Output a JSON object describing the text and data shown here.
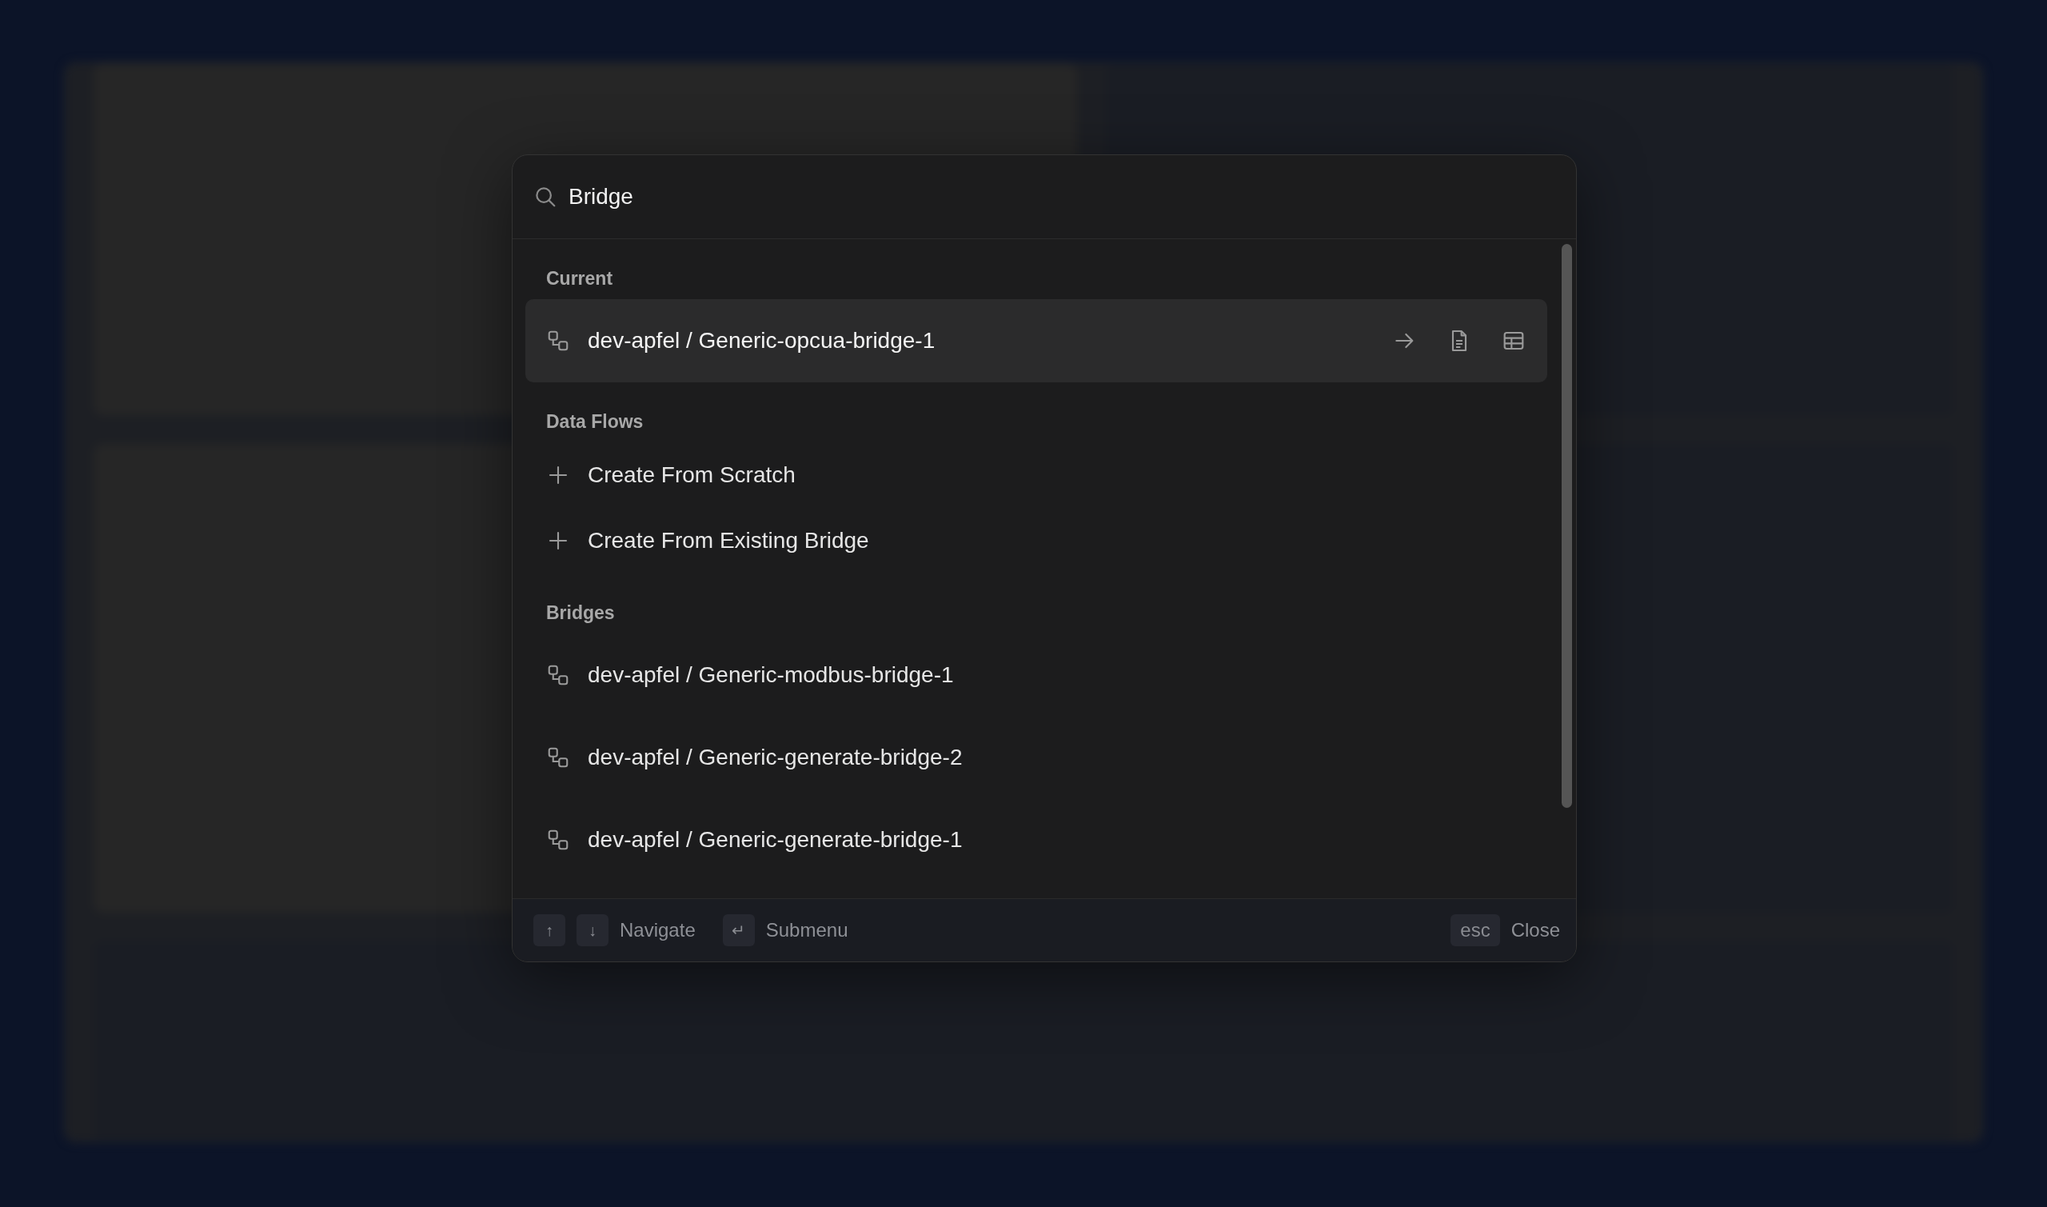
{
  "search": {
    "value": "Bridge"
  },
  "sections": [
    {
      "title": "Current",
      "items": [
        {
          "kind": "bridge",
          "label": "dev-apfel / Generic-opcua-bridge-1",
          "selected": true
        }
      ]
    },
    {
      "title": "Data Flows",
      "items": [
        {
          "kind": "create",
          "label": "Create From Scratch",
          "selected": false
        },
        {
          "kind": "create",
          "label": "Create From Existing Bridge",
          "selected": false
        }
      ]
    },
    {
      "title": "Bridges",
      "items": [
        {
          "kind": "bridge",
          "label": "dev-apfel / Generic-modbus-bridge-1",
          "selected": false
        },
        {
          "kind": "bridge",
          "label": "dev-apfel / Generic-generate-bridge-2",
          "selected": false
        },
        {
          "kind": "bridge",
          "label": "dev-apfel / Generic-generate-bridge-1",
          "selected": false
        }
      ]
    }
  ],
  "footer": {
    "left": [
      {
        "keys": [
          "↑",
          "↓"
        ],
        "label": "Navigate"
      },
      {
        "keys": [
          "↵"
        ],
        "label": "Submenu"
      }
    ],
    "right": [
      {
        "keys": [
          "esc"
        ],
        "label": "Close"
      }
    ]
  }
}
